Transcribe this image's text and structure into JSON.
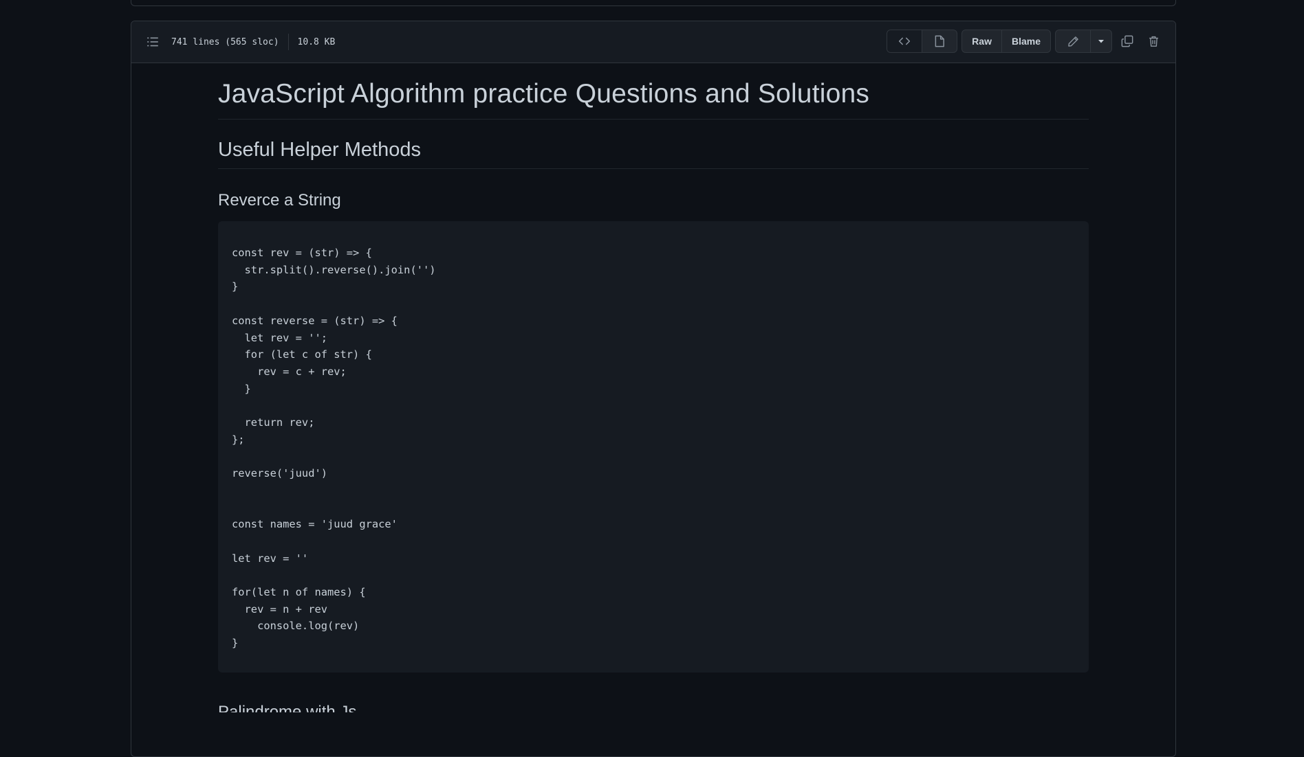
{
  "file_header": {
    "lines_info": "741 lines (565 sloc)",
    "size": "10.8 KB",
    "raw_label": "Raw",
    "blame_label": "Blame"
  },
  "icons": {
    "toc": "list-unordered-icon",
    "code": "code-icon",
    "preview": "file-icon",
    "edit": "pencil-icon",
    "dropdown": "triangle-down-icon",
    "copy": "copy-icon",
    "delete": "trash-icon"
  },
  "content": {
    "title": "JavaScript Algorithm practice Questions and Solutions",
    "section_heading": "Useful Helper Methods",
    "subsection_heading": "Reverce a String",
    "code_block": "const rev = (str) => {\n  str.split().reverse().join('')\n}\n\nconst reverse = (str) => {\n  let rev = '';\n  for (let c of str) {\n    rev = c + rev;\n  }\n\n  return rev;\n};\n\nreverse('juud')\n\n\nconst names = 'juud grace'\n\nlet rev = ''\n\nfor(let n of names) {\n  rev = n + rev\n    console.log(rev)\n}",
    "next_heading": "Palindrome with Js"
  },
  "colors": {
    "background": "#0d1117",
    "header_bg": "#161b22",
    "border": "#30363d",
    "text": "#c9d1d9",
    "code_bg": "#161b22"
  }
}
